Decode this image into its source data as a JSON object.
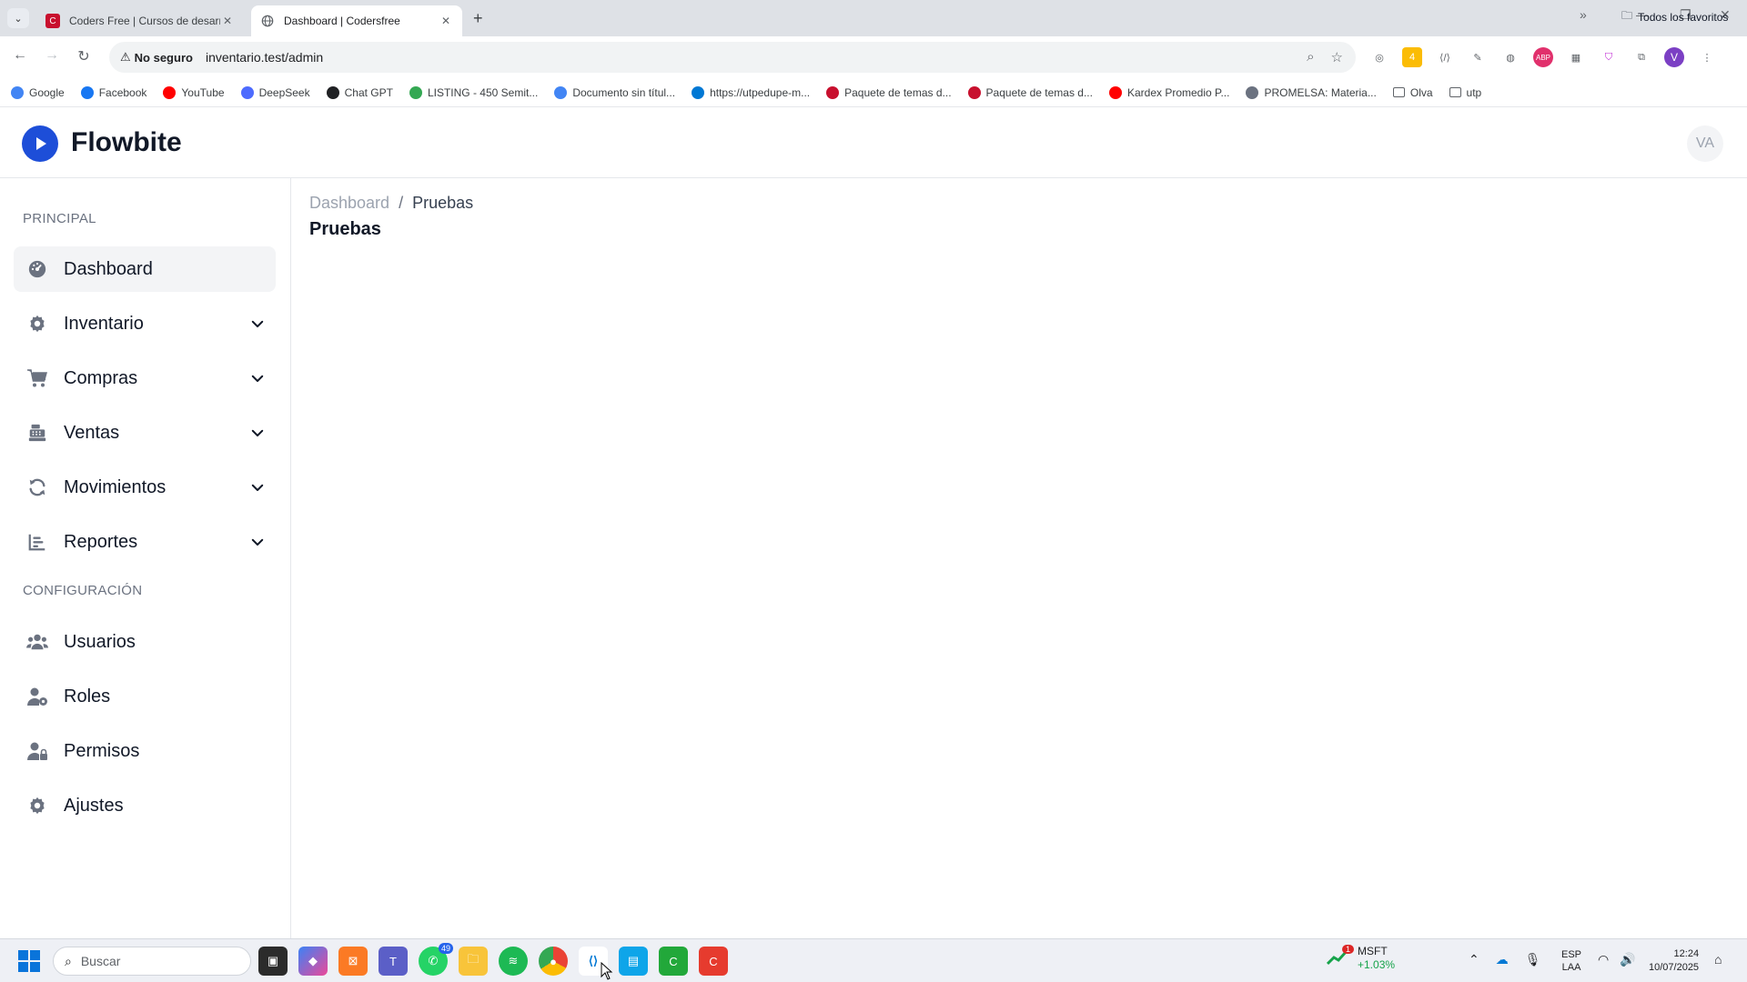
{
  "browser": {
    "tabs": [
      {
        "title": "Coders Free | Cursos de desarro",
        "favicon": "coders-free-favicon"
      },
      {
        "title": "Dashboard | Codersfree",
        "favicon": "globe-icon"
      }
    ],
    "security_label": "No seguro",
    "url": "inventario.test/admin",
    "profile_initial": "V",
    "bookmarks": [
      {
        "label": "Google",
        "color": "#4285f4"
      },
      {
        "label": "Facebook",
        "color": "#1877f2"
      },
      {
        "label": "YouTube",
        "color": "#ff0000"
      },
      {
        "label": "DeepSeek",
        "color": "#4d6bfe"
      },
      {
        "label": "Chat GPT",
        "color": "#202124"
      },
      {
        "label": "LISTING - 450 Semit...",
        "color": "#34a853"
      },
      {
        "label": "Documento sin títul...",
        "color": "#4285f4"
      },
      {
        "label": "https://utpedupe-m...",
        "color": "#0078d4"
      },
      {
        "label": "Paquete de temas d...",
        "color": "#c8102e"
      },
      {
        "label": "Paquete de temas d...",
        "color": "#c8102e"
      },
      {
        "label": "Kardex Promedio P...",
        "color": "#ff0000"
      },
      {
        "label": "PROMELSA: Materia...",
        "color": "#6b7280"
      },
      {
        "label": "Olva",
        "color": "folder"
      },
      {
        "label": "utp",
        "color": "folder"
      }
    ],
    "all_bookmarks": "Todos los favoritos"
  },
  "app": {
    "brand": "Flowbite",
    "avatar_initials": "VA",
    "accent": "#1d4ed8"
  },
  "sidebar": {
    "section_principal": "PRINCIPAL",
    "section_config": "CONFIGURACIÓN",
    "principal_items": [
      {
        "label": "Dashboard",
        "icon": "gauge-icon",
        "dropdown": false,
        "active": true
      },
      {
        "label": "Inventario",
        "icon": "gear-icon",
        "dropdown": true
      },
      {
        "label": "Compras",
        "icon": "cart-icon",
        "dropdown": true
      },
      {
        "label": "Ventas",
        "icon": "cash-register-icon",
        "dropdown": true
      },
      {
        "label": "Movimientos",
        "icon": "refresh-icon",
        "dropdown": true
      },
      {
        "label": "Reportes",
        "icon": "chart-bar-icon",
        "dropdown": true
      }
    ],
    "config_items": [
      {
        "label": "Usuarios",
        "icon": "users-icon"
      },
      {
        "label": "Roles",
        "icon": "user-gear-icon"
      },
      {
        "label": "Permisos",
        "icon": "user-lock-icon"
      },
      {
        "label": "Ajustes",
        "icon": "gear-icon"
      }
    ]
  },
  "main": {
    "breadcrumb": {
      "root": "Dashboard",
      "separator": "/",
      "current": "Pruebas"
    },
    "title": "Pruebas"
  },
  "taskbar": {
    "search_placeholder": "Buscar",
    "whatsapp_badge": "49",
    "stock_symbol": "MSFT",
    "stock_change": "+1.03%",
    "stock_badge": "1",
    "lang_top": "ESP",
    "lang_bottom": "LAA",
    "time": "12:24",
    "date": "10/07/2025"
  }
}
